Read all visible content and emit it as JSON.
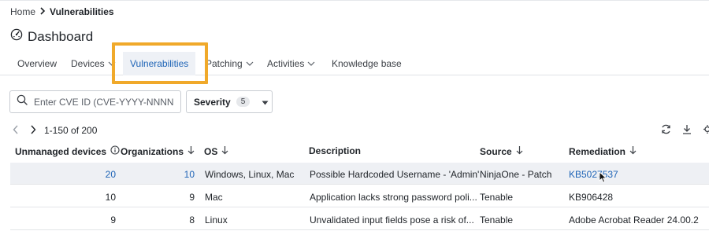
{
  "breadcrumb": {
    "home": "Home",
    "current": "Vulnerabilities"
  },
  "page": {
    "title": "Dashboard"
  },
  "tabs": [
    {
      "label": "Overview",
      "dropdown": false
    },
    {
      "label": "Devices",
      "dropdown": true
    },
    {
      "label": "Vulnerabilities",
      "dropdown": false,
      "active": true
    },
    {
      "label": "Patching",
      "dropdown": true
    },
    {
      "label": "Activities",
      "dropdown": true
    },
    {
      "label": "Knowledge base",
      "dropdown": false
    }
  ],
  "search": {
    "placeholder": "Enter CVE ID (CVE-YYYY-NNNNN)"
  },
  "filter": {
    "label": "Severity",
    "count": "5"
  },
  "pagination": {
    "range": "1-150 of 200"
  },
  "table": {
    "columns": [
      "Unmanaged devices",
      "Organizations",
      "OS",
      "Description",
      "Source",
      "Remediation"
    ],
    "rows": [
      {
        "unmanaged": "20",
        "organizations": "10",
        "os": "Windows, Linux, Mac",
        "description": "Possible Hardcoded Username - 'Admin'",
        "source": "NinjaOne - Patch",
        "remediation": "KB5027537",
        "selected": true
      },
      {
        "unmanaged": "10",
        "organizations": "9",
        "os": "Mac",
        "description": "Application lacks strong password poli...",
        "source": "Tenable",
        "remediation": "KB906428"
      },
      {
        "unmanaged": "9",
        "organizations": "8",
        "os": "Linux",
        "description": "Unvalidated input fields pose a risk of...",
        "source": "Tenable",
        "remediation": "Adobe Acrobat Reader 24.00.2"
      }
    ]
  },
  "colors": {
    "accent": "#1d63b6",
    "highlight": "#f0a92a",
    "selected_row": "#eef0f4"
  },
  "icons": [
    "dashboard-icon",
    "chevron-right-icon",
    "chevron-down-icon",
    "search-icon",
    "caret-down-icon",
    "chevron-left-icon",
    "refresh-icon",
    "download-icon",
    "info-icon",
    "sort-down-icon",
    "mouse-cursor-icon"
  ]
}
